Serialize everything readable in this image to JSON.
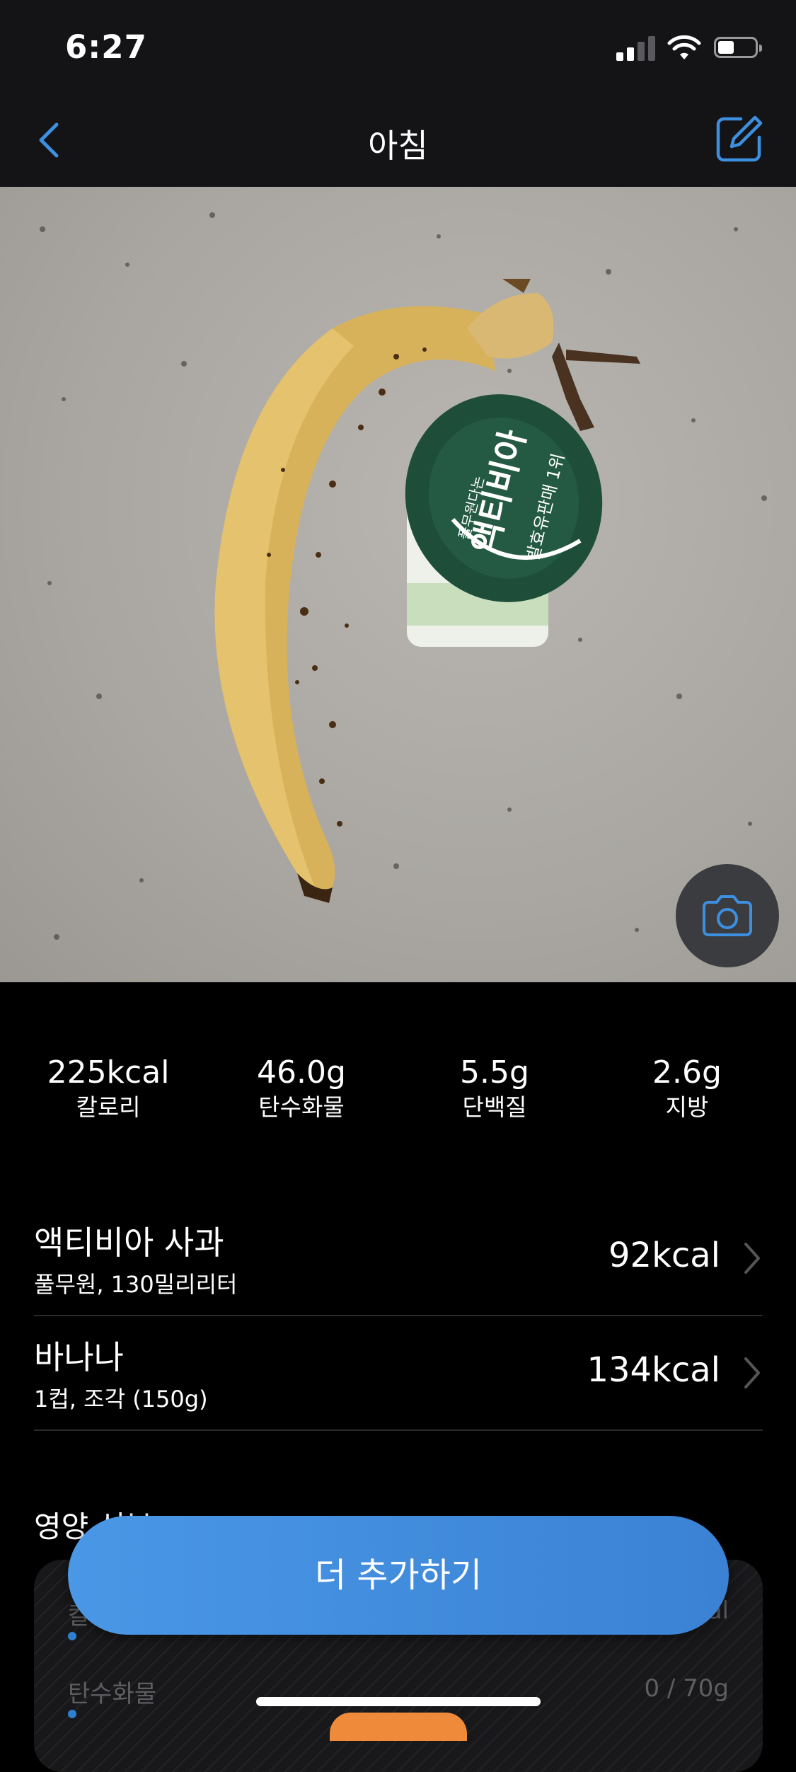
{
  "status_bar": {
    "time": "6:27"
  },
  "nav": {
    "title": "아침"
  },
  "macros": [
    {
      "value": "225kcal",
      "label": "칼로리"
    },
    {
      "value": "46.0g",
      "label": "탄수화물"
    },
    {
      "value": "5.5g",
      "label": "단백질"
    },
    {
      "value": "2.6g",
      "label": "지방"
    }
  ],
  "foods": [
    {
      "name": "액티비아 사과",
      "detail": "풀무원, 130밀리리터",
      "kcal": "92kcal"
    },
    {
      "name": "바나나",
      "detail": "1컵, 조각 (150g)",
      "kcal": "134kcal"
    }
  ],
  "nutrition": {
    "title": "영양 성분",
    "rows": [
      {
        "name": "칼로리",
        "value": "kcal"
      },
      {
        "name": "탄수화물",
        "value": "0 / 70g"
      }
    ]
  },
  "add_button": {
    "label": "더 추가하기"
  },
  "photo": {
    "yogurt_label": "액티비아",
    "yogurt_sublabel": "풀무원다논",
    "yogurt_tag": "발효유판매 1위"
  },
  "colors": {
    "accent": "#3d8fe0",
    "add_button": "#4a97e6",
    "background": "#000000"
  },
  "icons": [
    "back-chevron-icon",
    "edit-icon",
    "camera-icon",
    "chevron-right-icon"
  ]
}
